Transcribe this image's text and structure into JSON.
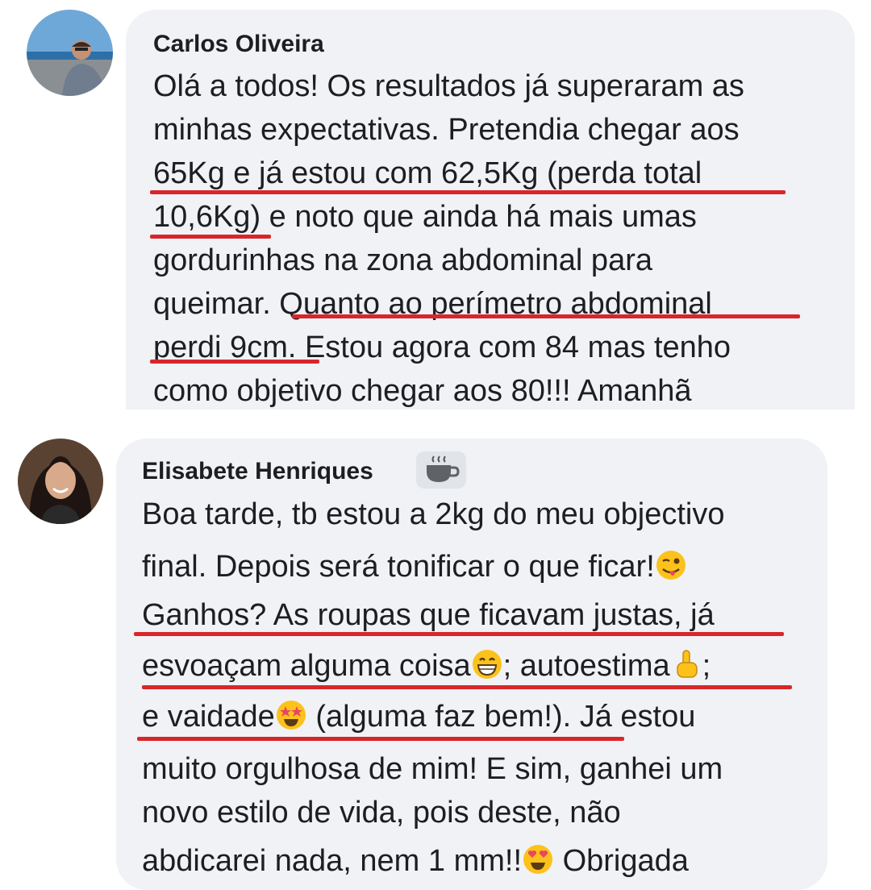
{
  "comments": [
    {
      "author": "Carlos Oliveira",
      "lines": [
        "Olá a todos! Os resultados já superaram as",
        "minhas expectativas. Pretendia chegar aos",
        "65Kg e já estou com 62,5Kg (perda total",
        "10,6Kg) e noto que ainda há mais umas",
        "gordurinhas na zona abdominal para",
        "queimar. Quanto ao perímetro abdominal",
        "perdi 9cm. Estou agora com 84 mas tenho",
        "como objetivo chegar aos 80!!! Amanhã"
      ],
      "avatar_icon": "avatar-photo-icon"
    },
    {
      "author": "Elisabete Henriques",
      "author_badge_icon": "coffee-cup-icon",
      "lines": [
        "Boa tarde, tb estou a 2kg do meu objectivo",
        "final. Depois será tonificar o que ficar!",
        "Ganhos? As roupas que ficavam justas, já",
        "esvoaçam alguma coisa",
        "; autoestima",
        ";",
        "e vaidade",
        " (alguma faz bem!). Já estou",
        "muito orgulhosa de mim! E sim, ganhei um",
        "novo estilo de vida, pois deste, não",
        "abdicarei nada, nem 1 mm!!",
        " Obrigada"
      ],
      "emojis": [
        "winking-tongue-emoji",
        "grinning-emoji",
        "pointing-up-emoji",
        "star-struck-emoji",
        "heart-eyes-emoji"
      ],
      "avatar_icon": "avatar-photo-icon"
    }
  ],
  "colors": {
    "bubble": "#f0f2f5",
    "underline": "#d8262b",
    "text": "#1c1e21"
  }
}
